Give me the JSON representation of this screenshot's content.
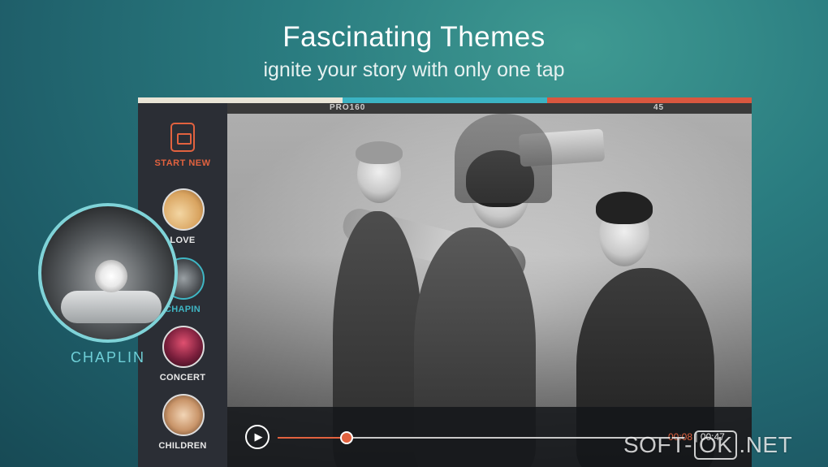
{
  "header": {
    "title": "Fascinating Themes",
    "subtitle": "ignite your story with only one tap"
  },
  "sidebar": {
    "start_label": "START NEW",
    "themes": [
      {
        "label": "LOVE"
      },
      {
        "label": "CHAPIN"
      },
      {
        "label": "CONCERT"
      },
      {
        "label": "CHILDREN"
      }
    ]
  },
  "film": {
    "left_code": "PRO160",
    "right_code": "45"
  },
  "player": {
    "current_time": "00:08",
    "separator": " | ",
    "total_time": "00:47",
    "progress": 0.18
  },
  "bubble": {
    "label": "CHAPLIN"
  },
  "watermark": {
    "pre": "SOFT-",
    "boxed": "OK",
    "post": ".NET"
  },
  "colors": {
    "accent_orange": "#e2623f",
    "accent_teal": "#3fb6c4",
    "stripe_cream": "#e9e4d6",
    "stripe_teal": "#3bb3c3",
    "stripe_red": "#d9573f"
  }
}
